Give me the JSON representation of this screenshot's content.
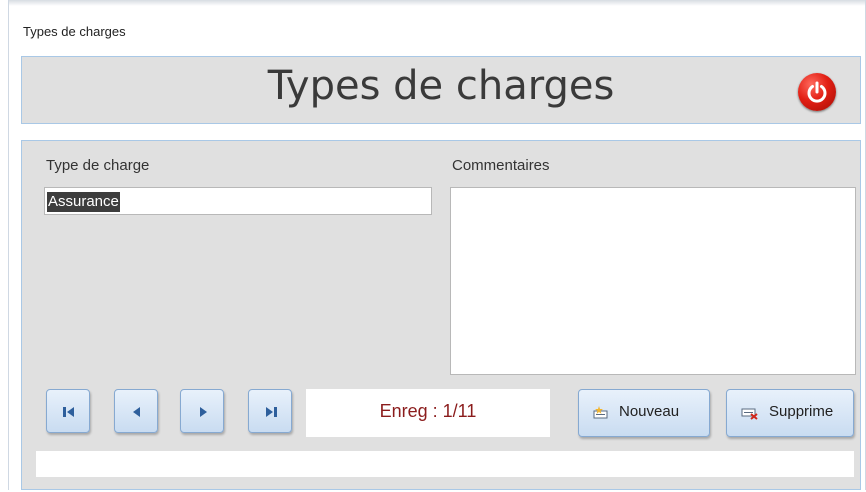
{
  "window": {
    "title": "Types de charges"
  },
  "header": {
    "title": "Types de charges",
    "close_icon": "power-icon"
  },
  "form": {
    "type_label": "Type de charge",
    "type_value": "Assurance",
    "comments_label": "Commentaires",
    "comments_value": ""
  },
  "navigation": {
    "first_icon": "first-record-icon",
    "prev_icon": "previous-record-icon",
    "next_icon": "next-record-icon",
    "last_icon": "last-record-icon",
    "record_text": "Enreg : 1/11"
  },
  "actions": {
    "new_label": "Nouveau",
    "delete_label": "Supprime"
  },
  "colors": {
    "form_background": "#e0e0e0",
    "button_blue": "#c9dcf1",
    "record_text": "#8b1c1c",
    "power_red": "#e21f14"
  }
}
